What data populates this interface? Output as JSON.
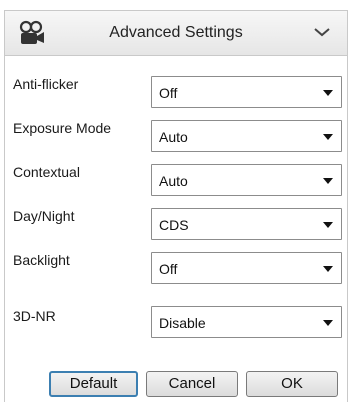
{
  "header": {
    "title": "Advanced Settings",
    "logo_icon": "camera-group-icon",
    "toggle_icon": "chevron-down-icon"
  },
  "settings": [
    {
      "label": "Anti-flicker",
      "value": "Off"
    },
    {
      "label": "Exposure Mode",
      "value": "Auto"
    },
    {
      "label": "Contextual",
      "value": "Auto"
    },
    {
      "label": "Day/Night",
      "value": "CDS"
    },
    {
      "label": "Backlight",
      "value": "Off"
    },
    {
      "label": "3D-NR",
      "value": "Disable"
    }
  ],
  "buttons": {
    "default": "Default",
    "cancel": "Cancel",
    "ok": "OK"
  },
  "colors": {
    "default_button_border": "#3c7fb1"
  }
}
